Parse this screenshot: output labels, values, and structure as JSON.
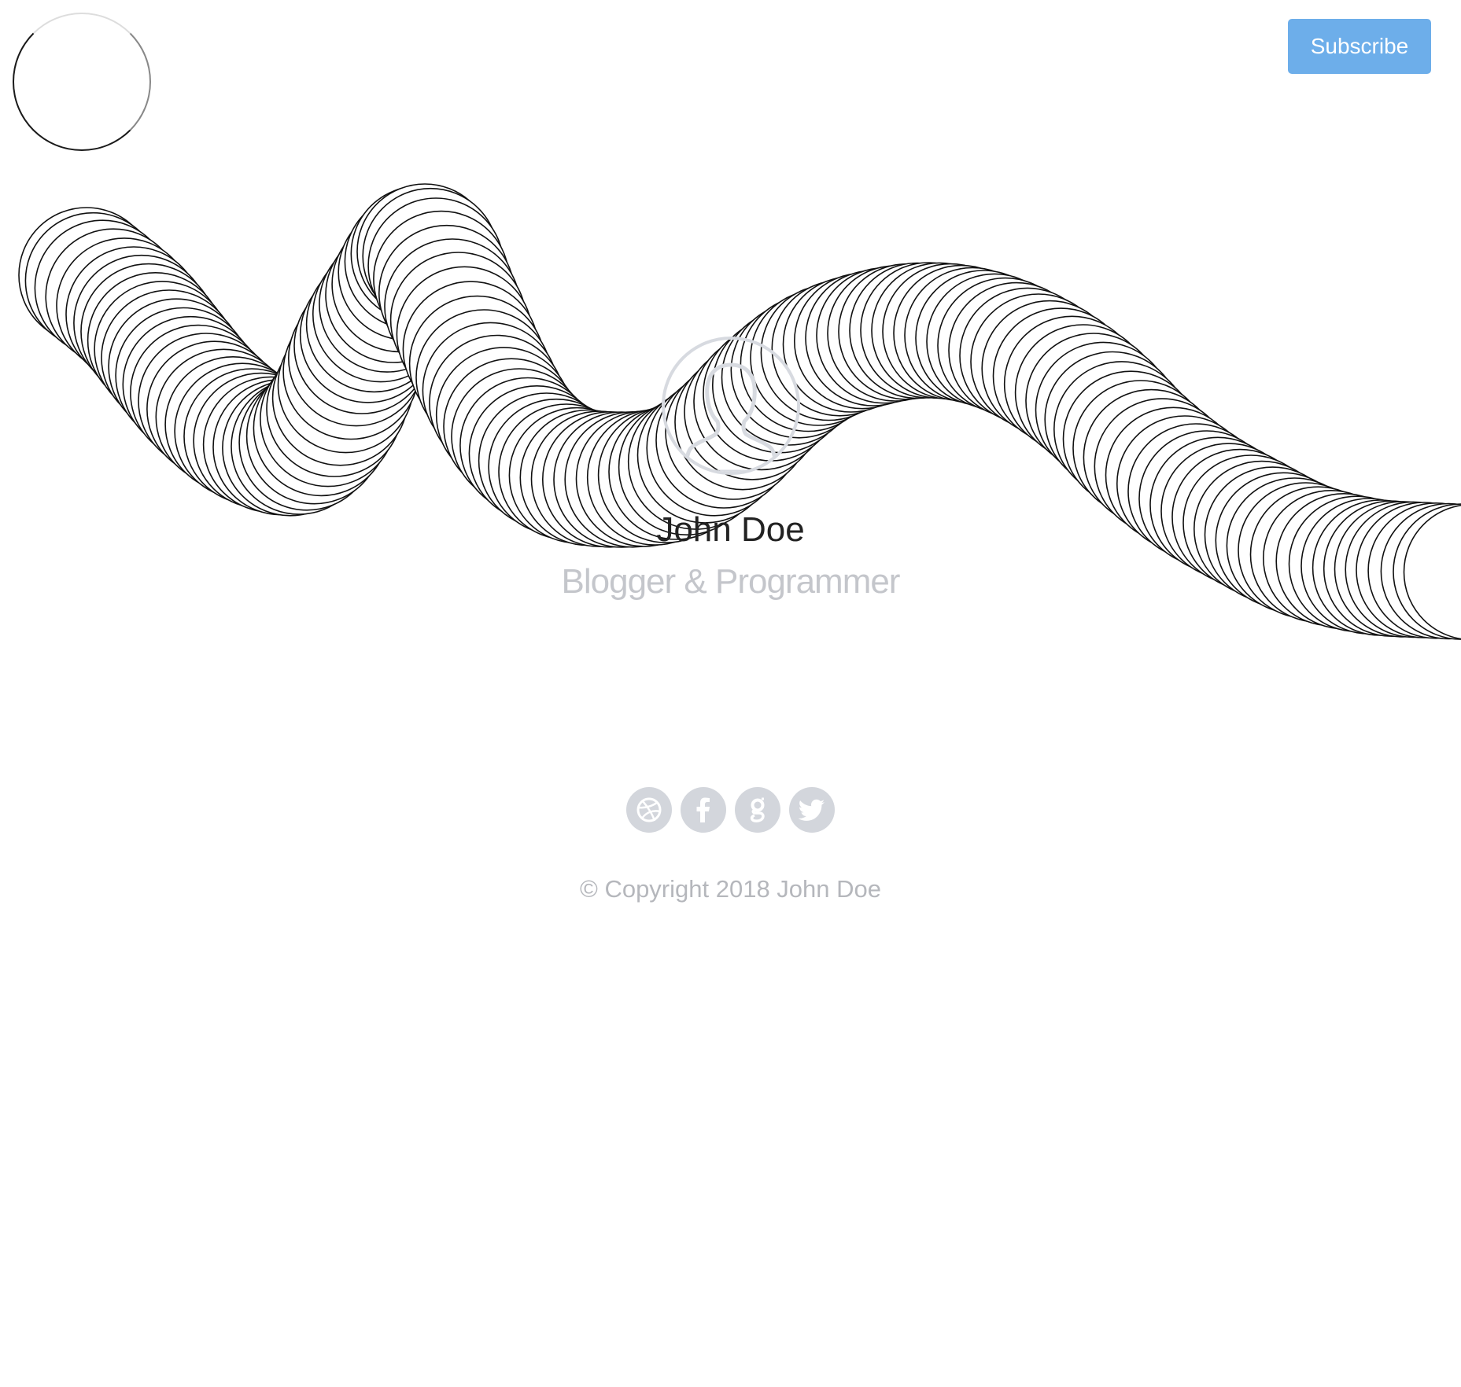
{
  "header": {
    "subscribe_label": "Subscribe"
  },
  "profile": {
    "name": "John Doe",
    "role": "Blogger & Programmer",
    "avatar_icon": "user-silhouette-icon"
  },
  "social": [
    {
      "name": "dribbble",
      "icon": "dribbble-icon"
    },
    {
      "name": "facebook",
      "icon": "facebook-icon"
    },
    {
      "name": "google",
      "icon": "google-icon"
    },
    {
      "name": "twitter",
      "icon": "twitter-icon"
    }
  ],
  "footer": {
    "copyright": "© Copyright 2018 John Doe"
  },
  "colors": {
    "accent": "#6daeea",
    "social_bg": "#d3d6dc",
    "muted_text": "#b5b7bc",
    "name_text": "#222222",
    "ring_stroke": "#111111"
  }
}
